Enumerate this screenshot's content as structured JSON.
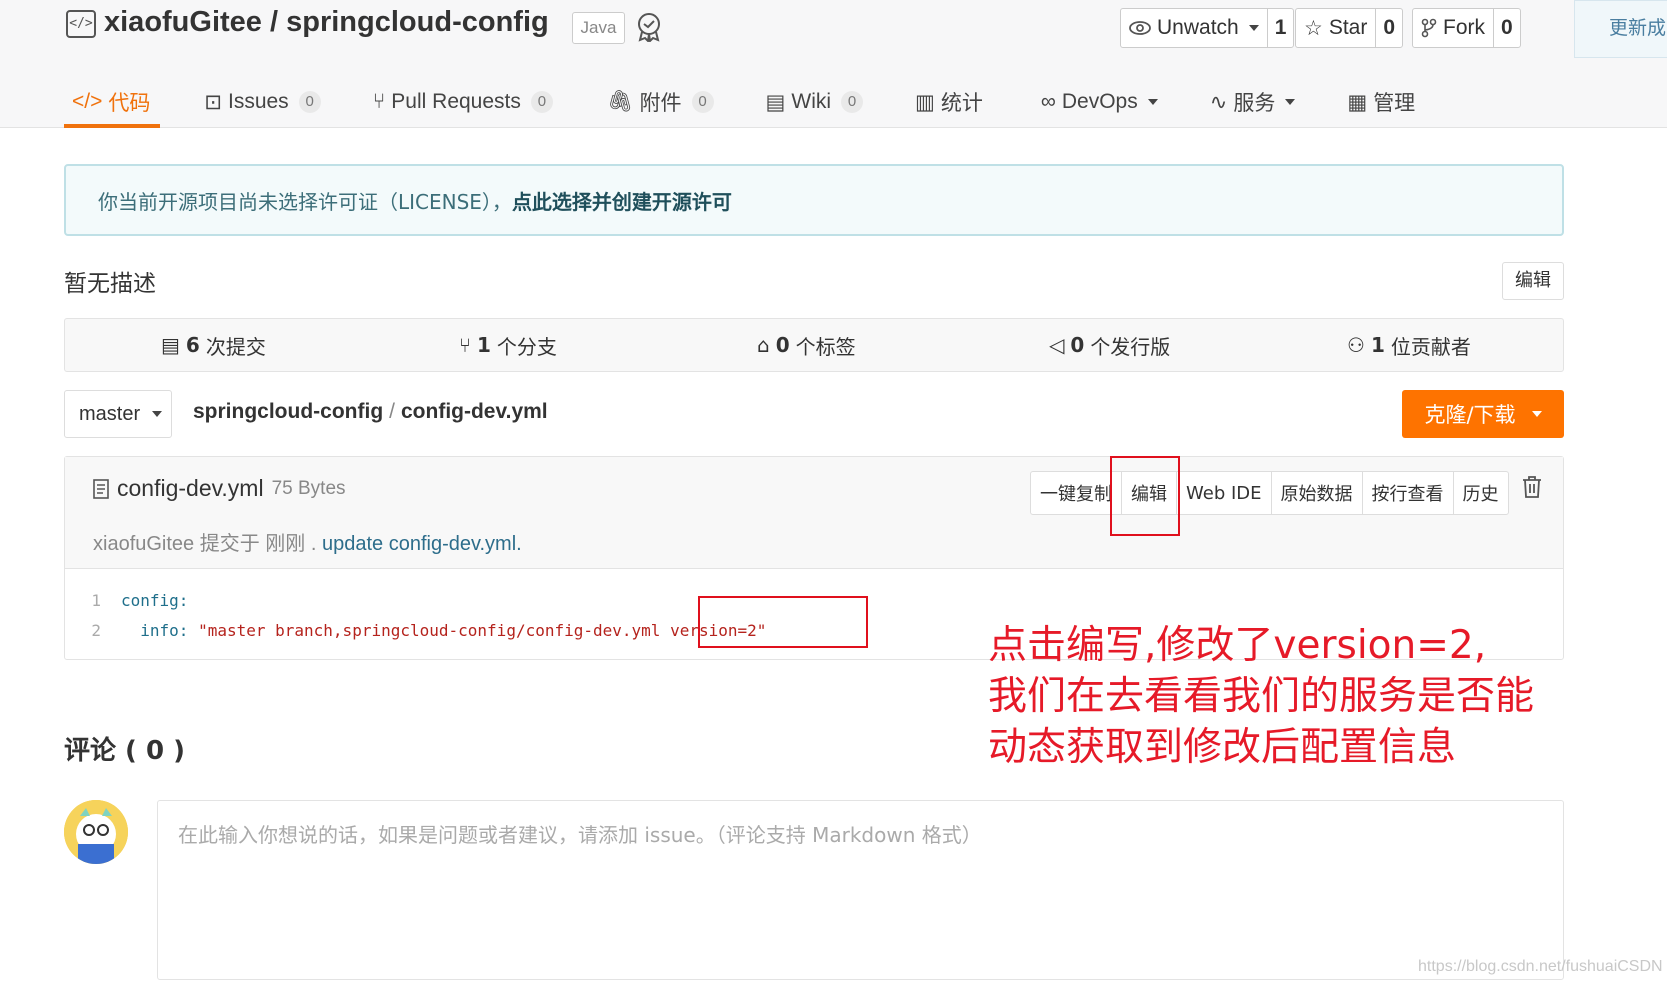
{
  "repo": {
    "owner": "xiaofuGitee",
    "separator": "/",
    "name": "springcloud-config",
    "language": "Java"
  },
  "actions": {
    "watch_label": "Unwatch",
    "watch_count": "1",
    "star_label": "Star",
    "star_count": "0",
    "fork_label": "Fork",
    "fork_count": "0",
    "update_label": "更新成"
  },
  "nav": {
    "code": "代码",
    "issues": "Issues",
    "issues_count": "0",
    "pulls": "Pull Requests",
    "pulls_count": "0",
    "attachments": "附件",
    "attachments_count": "0",
    "wiki": "Wiki",
    "wiki_count": "0",
    "stats": "统计",
    "devops": "DevOps",
    "services": "服务",
    "manage": "管理"
  },
  "banner": {
    "text": "你当前开源项目尚未选择许可证（LICENSE），",
    "link": "点此选择并创建开源许可"
  },
  "description": {
    "text": "暂无描述",
    "edit_label": "编辑"
  },
  "stats": {
    "commits_num": "6",
    "commits_label": "次提交",
    "branches_num": "1",
    "branches_label": "个分支",
    "tags_num": "0",
    "tags_label": "个标签",
    "releases_num": "0",
    "releases_label": "个发行版",
    "contributors_num": "1",
    "contributors_label": "位贡献者"
  },
  "branch": {
    "current": "master"
  },
  "breadcrumb": {
    "repo": "springcloud-config",
    "sep": "/",
    "file": "config-dev.yml"
  },
  "clone_label": "克隆/下载",
  "file": {
    "name": "config-dev.yml",
    "size": "75 Bytes",
    "commit_author": "xiaofuGitee 提交于 刚刚 . ",
    "commit_message": "update config-dev.yml.",
    "tools": {
      "copy": "一键复制",
      "edit": "编辑",
      "webide": "Web IDE",
      "raw": "原始数据",
      "blame": "按行查看",
      "history": "历史"
    },
    "code": [
      {
        "num": "1",
        "key": "config:",
        "value": ""
      },
      {
        "num": "2",
        "key": "  info: ",
        "value": "\"master branch,springcloud-config/config-dev.yml version=2\""
      }
    ]
  },
  "annotation": {
    "line1": "点击编写,修改了version=2,",
    "line2": "我们在去看看我们的服务是否能",
    "line3": "动态获取到修改后配置信息"
  },
  "comments": {
    "title": "评论 ( 0 )",
    "placeholder": "在此输入你想说的话，如果是问题或者建议，请添加 issue。（评论支持 Markdown 格式）"
  },
  "watermark": "https://blog.csdn.net/fushuaiCSDN"
}
